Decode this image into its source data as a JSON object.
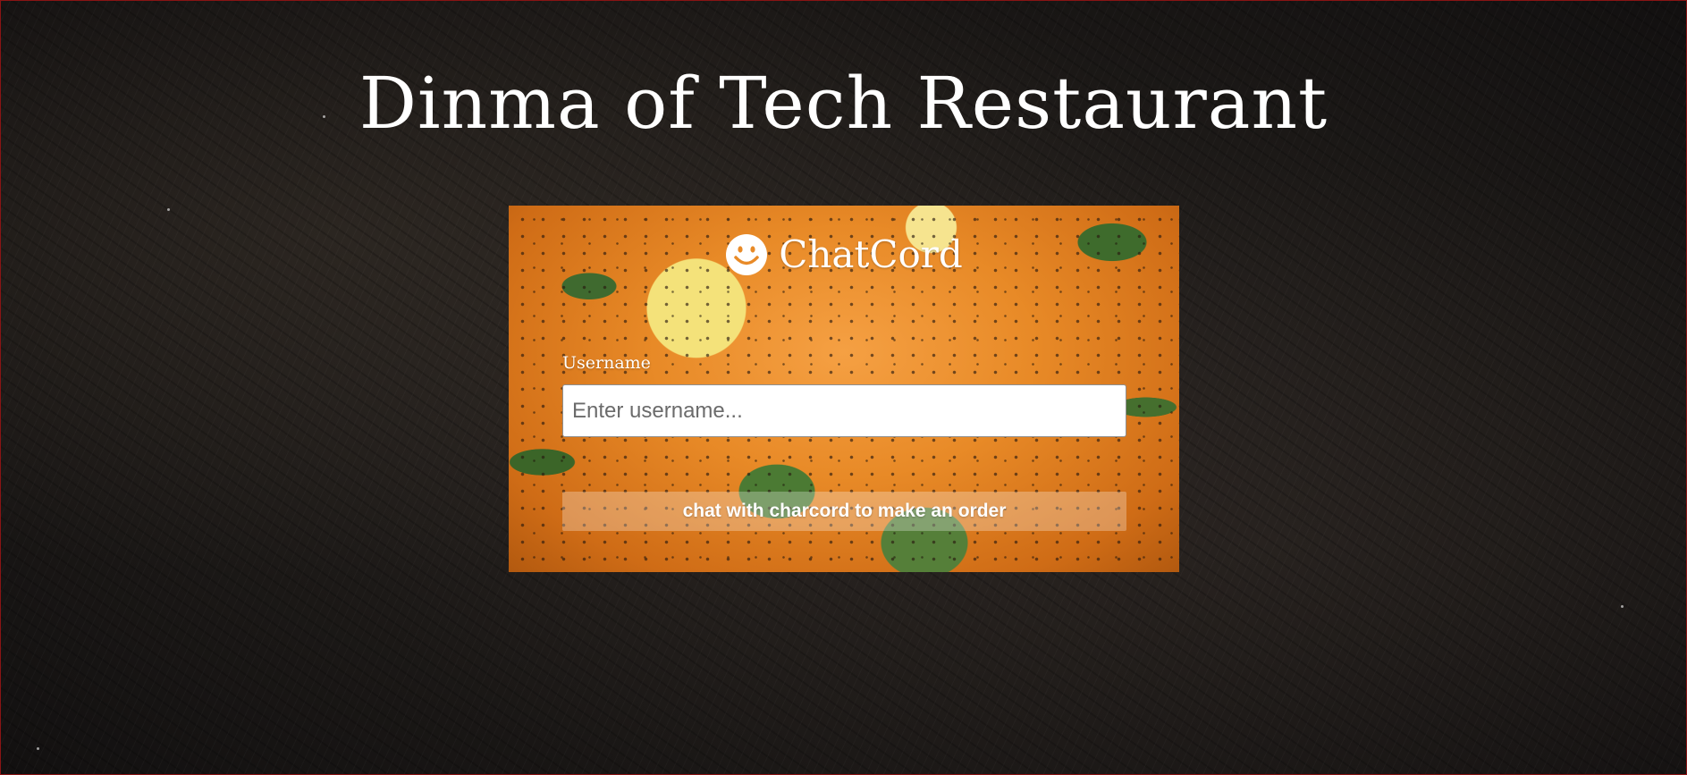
{
  "page": {
    "title": "Dinma of Tech Restaurant"
  },
  "card": {
    "brand_icon": "smile-icon",
    "brand_name": "ChatCord",
    "username_label": "Username",
    "username_placeholder": "Enter username...",
    "username_value": "",
    "submit_label": "chat with charcord to make an order"
  },
  "colors": {
    "page_background": "#1c1917",
    "text": "#ffffff",
    "card_accent": "#e88a27",
    "border": "#8a1414"
  }
}
